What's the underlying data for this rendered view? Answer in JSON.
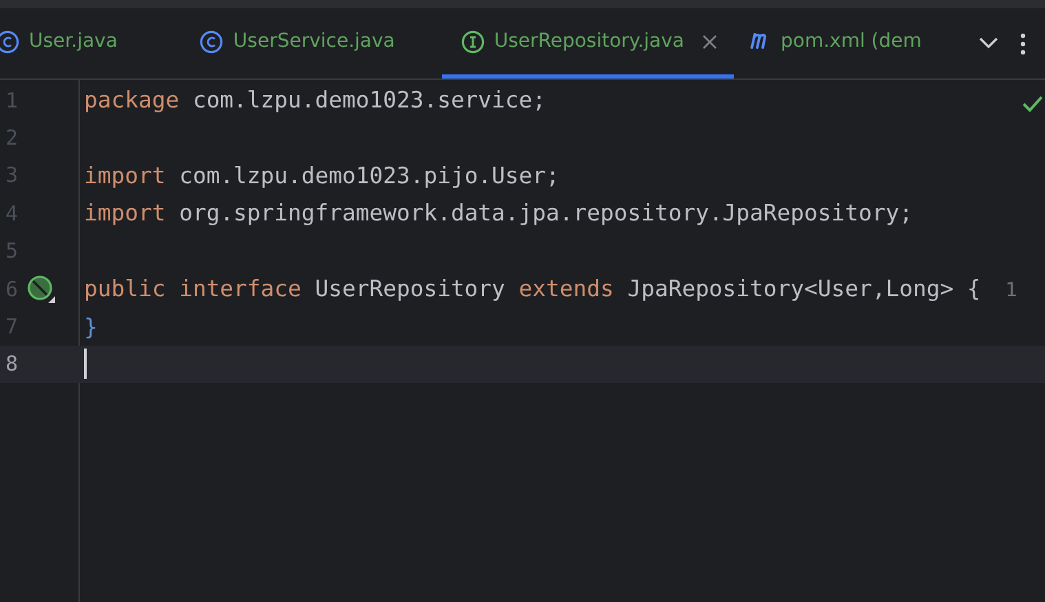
{
  "tabs": [
    {
      "label": "User.java",
      "kind": "class",
      "selected": false
    },
    {
      "label": "UserService.java",
      "kind": "class",
      "selected": false
    },
    {
      "label": "UserRepository.java",
      "kind": "interface",
      "selected": true
    },
    {
      "label": "pom.xml (dem",
      "kind": "maven",
      "selected": false
    }
  ],
  "editor": {
    "lines": [
      {
        "number": "1",
        "tokens": [
          {
            "kind": "keyword",
            "text": "package"
          },
          {
            "kind": "plain",
            "text": " com.lzpu.demo1023.service;"
          }
        ]
      },
      {
        "number": "2"
      },
      {
        "number": "3",
        "tokens": [
          {
            "kind": "keyword",
            "text": "import"
          },
          {
            "kind": "plain",
            "text": " com.lzpu.demo1023.pijo.User;"
          }
        ]
      },
      {
        "number": "4",
        "tokens": [
          {
            "kind": "keyword",
            "text": "import"
          },
          {
            "kind": "plain",
            "text": " org.springframework.data.jpa.repository.JpaRepository;"
          }
        ]
      },
      {
        "number": "5"
      },
      {
        "number": "6",
        "marker": true,
        "tokens": [
          {
            "kind": "keyword",
            "text": "public "
          },
          {
            "kind": "keyword",
            "text": "interface"
          },
          {
            "kind": "plain",
            "text": " UserRepository "
          },
          {
            "kind": "keyword",
            "text": "extends"
          },
          {
            "kind": "plain",
            "text": " JpaRepository<User,Long> {"
          },
          {
            "kind": "hint",
            "text": "1"
          }
        ]
      },
      {
        "number": "7",
        "tokens": [
          {
            "kind": "brace",
            "text": "}"
          }
        ]
      },
      {
        "number": "8",
        "current": true
      }
    ]
  }
}
